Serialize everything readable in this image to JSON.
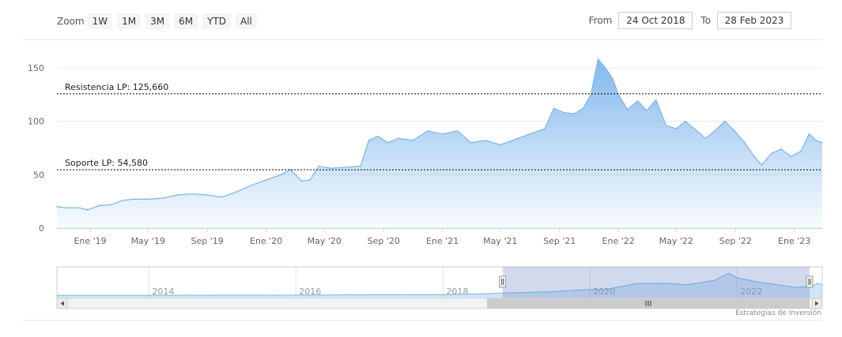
{
  "range_selector": {
    "zoom_label": "Zoom",
    "buttons": [
      "1W",
      "1M",
      "3M",
      "6M",
      "YTD",
      "All"
    ],
    "from_label": "From",
    "from_value": "24 Oct 2018",
    "to_label": "To",
    "to_value": "28 Feb 2023"
  },
  "credits": "Estrategias de Inversión",
  "colors": {
    "line": "#7cb5ec",
    "plot_lines": "#000000",
    "navigator_mask": "#d9def0"
  },
  "chart_data": {
    "type": "area",
    "title": "",
    "xlabel": "",
    "ylabel": "",
    "ylim": [
      0,
      175
    ],
    "yticks": [
      0,
      50,
      100,
      150
    ],
    "xlim": [
      "2018-10-24",
      "2023-02-28"
    ],
    "xtick_labels": [
      {
        "date": "2019-01-01",
        "label": "Ene '19"
      },
      {
        "date": "2019-05-01",
        "label": "May '19"
      },
      {
        "date": "2019-09-01",
        "label": "Sep '19"
      },
      {
        "date": "2020-01-01",
        "label": "Ene '20"
      },
      {
        "date": "2020-05-01",
        "label": "May '20"
      },
      {
        "date": "2020-09-01",
        "label": "Sep '20"
      },
      {
        "date": "2021-01-01",
        "label": "Ene '21"
      },
      {
        "date": "2021-05-01",
        "label": "May '21"
      },
      {
        "date": "2021-09-01",
        "label": "Sep '21"
      },
      {
        "date": "2022-01-01",
        "label": "Ene '22"
      },
      {
        "date": "2022-05-01",
        "label": "May '22"
      },
      {
        "date": "2022-09-01",
        "label": "Sep '22"
      },
      {
        "date": "2023-01-01",
        "label": "Ene '23"
      }
    ],
    "plot_lines": [
      {
        "label": "Resistencia LP: 125,660",
        "value": 125.66
      },
      {
        "label": "Soporte LP: 54,580",
        "value": 54.58
      }
    ],
    "grid": true,
    "series": [
      {
        "values": [
          [
            "2018-10-24",
            20
          ],
          [
            "2018-11-15",
            19
          ],
          [
            "2018-12-10",
            19
          ],
          [
            "2018-12-26",
            17
          ],
          [
            "2019-01-20",
            21
          ],
          [
            "2019-02-15",
            22
          ],
          [
            "2019-03-10",
            26
          ],
          [
            "2019-04-01",
            27
          ],
          [
            "2019-05-01",
            27
          ],
          [
            "2019-06-01",
            28
          ],
          [
            "2019-07-01",
            31
          ],
          [
            "2019-08-01",
            32
          ],
          [
            "2019-09-01",
            31
          ],
          [
            "2019-10-01",
            29
          ],
          [
            "2019-11-01",
            34
          ],
          [
            "2019-12-01",
            40
          ],
          [
            "2020-01-01",
            45
          ],
          [
            "2020-02-01",
            50
          ],
          [
            "2020-02-20",
            55
          ],
          [
            "2020-03-15",
            44
          ],
          [
            "2020-04-01",
            45
          ],
          [
            "2020-04-20",
            58
          ],
          [
            "2020-05-15",
            56
          ],
          [
            "2020-06-15",
            57
          ],
          [
            "2020-07-15",
            58
          ],
          [
            "2020-08-01",
            82
          ],
          [
            "2020-08-20",
            86
          ],
          [
            "2020-09-10",
            80
          ],
          [
            "2020-10-01",
            84
          ],
          [
            "2020-11-01",
            82
          ],
          [
            "2020-12-01",
            91
          ],
          [
            "2021-01-01",
            88
          ],
          [
            "2021-02-01",
            91
          ],
          [
            "2021-03-01",
            80
          ],
          [
            "2021-04-01",
            82
          ],
          [
            "2021-05-01",
            78
          ],
          [
            "2021-06-01",
            83
          ],
          [
            "2021-07-01",
            88
          ],
          [
            "2021-08-01",
            93
          ],
          [
            "2021-08-20",
            112
          ],
          [
            "2021-09-10",
            108
          ],
          [
            "2021-10-01",
            107
          ],
          [
            "2021-10-20",
            112
          ],
          [
            "2021-11-05",
            125
          ],
          [
            "2021-11-20",
            158
          ],
          [
            "2021-12-05",
            150
          ],
          [
            "2021-12-20",
            140
          ],
          [
            "2022-01-01",
            125
          ],
          [
            "2022-01-20",
            111
          ],
          [
            "2022-02-10",
            119
          ],
          [
            "2022-03-01",
            110
          ],
          [
            "2022-03-20",
            120
          ],
          [
            "2022-04-10",
            96
          ],
          [
            "2022-05-01",
            93
          ],
          [
            "2022-05-20",
            100
          ],
          [
            "2022-06-10",
            92
          ],
          [
            "2022-07-01",
            84
          ],
          [
            "2022-07-20",
            91
          ],
          [
            "2022-08-10",
            100
          ],
          [
            "2022-09-01",
            90
          ],
          [
            "2022-09-20",
            80
          ],
          [
            "2022-10-10",
            67
          ],
          [
            "2022-10-25",
            59
          ],
          [
            "2022-11-15",
            70
          ],
          [
            "2022-12-05",
            74
          ],
          [
            "2022-12-25",
            67
          ],
          [
            "2023-01-15",
            72
          ],
          [
            "2023-02-01",
            88
          ],
          [
            "2023-02-15",
            82
          ],
          [
            "2023-02-28",
            80
          ]
        ]
      }
    ]
  },
  "navigator": {
    "year_labels": [
      "2014",
      "2016",
      "2018",
      "2020",
      "2022"
    ],
    "ylim": [
      0,
      175
    ],
    "values": [
      [
        "2012-10-01",
        4
      ],
      [
        "2014-01-01",
        5
      ],
      [
        "2016-01-01",
        6
      ],
      [
        "2018-01-01",
        10
      ],
      [
        "2018-07-01",
        14
      ],
      [
        "2018-10-24",
        20
      ],
      [
        "2019-06-01",
        28
      ],
      [
        "2020-01-01",
        45
      ],
      [
        "2020-03-15",
        44
      ],
      [
        "2020-08-20",
        86
      ],
      [
        "2021-01-01",
        88
      ],
      [
        "2021-05-01",
        78
      ],
      [
        "2021-09-10",
        108
      ],
      [
        "2021-11-20",
        158
      ],
      [
        "2022-01-01",
        125
      ],
      [
        "2022-05-01",
        93
      ],
      [
        "2022-10-25",
        59
      ],
      [
        "2023-01-15",
        72
      ],
      [
        "2023-02-01",
        88
      ],
      [
        "2023-02-28",
        80
      ]
    ],
    "selected_range": [
      "2018-10-24",
      "2023-02-28"
    ]
  }
}
